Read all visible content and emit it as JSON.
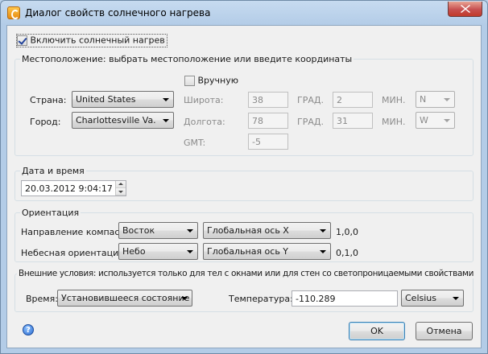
{
  "window": {
    "title": "Диалог свойств солнечного нагрева",
    "icon": "app-c-icon",
    "close_icon": "close-icon"
  },
  "enable": {
    "label": "Включить солнечный нагрев",
    "checked": true
  },
  "location": {
    "legend": "Местоположение: выбрать местоположение или введите координаты",
    "manual_label": "Вручную",
    "manual_checked": false,
    "country_label": "Страна:",
    "country_value": "United States",
    "city_label": "Город:",
    "city_value": "Charlottesville Va.",
    "latitude_label": "Широта:",
    "latitude_deg": "38",
    "latitude_min": "2",
    "latitude_dir": "N",
    "longitude_label": "Долгота:",
    "longitude_deg": "78",
    "longitude_min": "31",
    "longitude_dir": "W",
    "deg_label": "ГРАД.",
    "min_label": "МИН.",
    "gmt_label": "GMT:",
    "gmt_value": "-5"
  },
  "datetime": {
    "legend": "Дата и время",
    "value": "20.03.2012 9:04:17"
  },
  "orientation": {
    "legend": "Ориентация",
    "compass_label": "Направление компаса:",
    "compass_value": "Восток",
    "compass_axis": "Глобальная ось X",
    "compass_vector": "1,0,0",
    "sky_label": "Небесная ориентация:",
    "sky_value": "Небо",
    "sky_axis": "Глобальная ось Y",
    "sky_vector": "0,1,0"
  },
  "external": {
    "legend": "Внешние условия: используется только для тел с окнами или для стен со светопроницаемыми свойствами",
    "time_label": "Время:",
    "time_value": "Установившееся состояние",
    "temp_label": "Температура:",
    "temp_value": "-110.289",
    "unit_value": "Celsius"
  },
  "footer": {
    "help_icon": "help-icon",
    "ok_label": "OK",
    "cancel_label": "Отмена"
  }
}
